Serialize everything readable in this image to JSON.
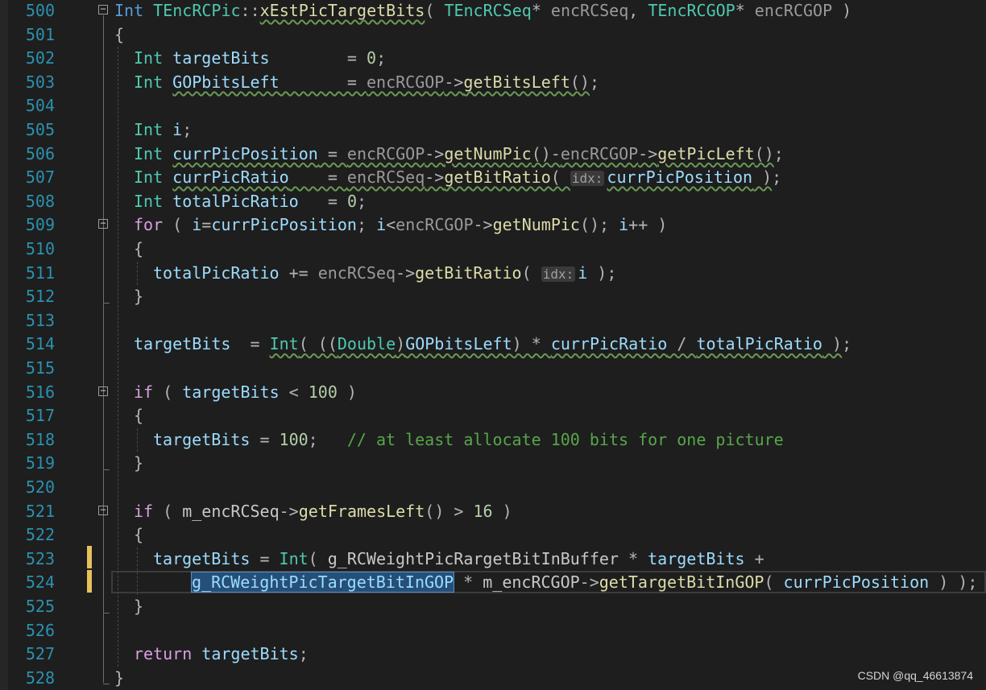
{
  "editor": {
    "line_numbers": [
      "500",
      "501",
      "502",
      "503",
      "504",
      "505",
      "506",
      "507",
      "508",
      "509",
      "510",
      "511",
      "512",
      "513",
      "514",
      "515",
      "516",
      "517",
      "518",
      "519",
      "520",
      "521",
      "522",
      "523",
      "524",
      "525",
      "526",
      "527",
      "528"
    ],
    "fold_glyph": "−",
    "lines": [
      {
        "indent": 0,
        "tokens": [
          {
            "c": "keyword",
            "t": "Int "
          },
          {
            "c": "type",
            "t": "TEncRCPic"
          },
          {
            "c": "punct",
            "t": "::"
          },
          {
            "c": "func",
            "t": "xEstPicTargetBits",
            "sq": true
          },
          {
            "c": "punct",
            "t": "( "
          },
          {
            "c": "type",
            "t": "TEncRCSeq"
          },
          {
            "c": "punct",
            "t": "* "
          },
          {
            "c": "param",
            "t": "encRCSeq"
          },
          {
            "c": "punct",
            "t": ", "
          },
          {
            "c": "type",
            "t": "TEncRCGOP"
          },
          {
            "c": "punct",
            "t": "* "
          },
          {
            "c": "param",
            "t": "encRCGOP"
          },
          {
            "c": "punct",
            "t": " )"
          }
        ]
      },
      {
        "indent": 0,
        "tokens": [
          {
            "c": "punct",
            "t": "{"
          }
        ]
      },
      {
        "indent": 1,
        "tokens": [
          {
            "c": "type",
            "t": "Int "
          },
          {
            "c": "var",
            "t": "targetBits"
          },
          {
            "c": "punct",
            "t": "        = "
          },
          {
            "c": "num",
            "t": "0"
          },
          {
            "c": "punct",
            "t": ";"
          }
        ]
      },
      {
        "indent": 1,
        "tokens": [
          {
            "c": "type",
            "t": "Int "
          },
          {
            "c": "var",
            "t": "GOPbitsLeft",
            "sq": true
          },
          {
            "c": "punct",
            "t": "       = ",
            "sq": true
          },
          {
            "c": "param",
            "t": "encRCGOP",
            "sq": true
          },
          {
            "c": "punct",
            "t": "->",
            "sq": true
          },
          {
            "c": "func",
            "t": "getBitsLeft",
            "sq": true
          },
          {
            "c": "punct",
            "t": "()",
            "sq": true
          },
          {
            "c": "punct",
            "t": ";"
          }
        ]
      },
      {
        "indent": 1,
        "tokens": []
      },
      {
        "indent": 1,
        "tokens": [
          {
            "c": "type",
            "t": "Int "
          },
          {
            "c": "var",
            "t": "i"
          },
          {
            "c": "punct",
            "t": ";"
          }
        ]
      },
      {
        "indent": 1,
        "tokens": [
          {
            "c": "type",
            "t": "Int "
          },
          {
            "c": "var",
            "t": "currPicPosition",
            "sq": true
          },
          {
            "c": "punct",
            "t": " = ",
            "sq": true
          },
          {
            "c": "param",
            "t": "encRCGOP",
            "sq": true
          },
          {
            "c": "punct",
            "t": "->",
            "sq": true
          },
          {
            "c": "func",
            "t": "getNumPic",
            "sq": true
          },
          {
            "c": "punct",
            "t": "()-",
            "sq": true
          },
          {
            "c": "param",
            "t": "encRCGOP",
            "sq": true
          },
          {
            "c": "punct",
            "t": "->",
            "sq": true
          },
          {
            "c": "func",
            "t": "getPicLeft",
            "sq": true
          },
          {
            "c": "punct",
            "t": "()",
            "sq": true
          },
          {
            "c": "punct",
            "t": ";"
          }
        ]
      },
      {
        "indent": 1,
        "tokens": [
          {
            "c": "type",
            "t": "Int "
          },
          {
            "c": "var",
            "t": "currPicRatio",
            "sq": true
          },
          {
            "c": "punct",
            "t": "    = ",
            "sq": true
          },
          {
            "c": "param",
            "t": "encRCSeq",
            "sq": true
          },
          {
            "c": "punct",
            "t": "->",
            "sq": true
          },
          {
            "c": "func",
            "t": "getBitRatio",
            "sq": true
          },
          {
            "c": "punct",
            "t": "( ",
            "sq": true
          },
          {
            "c": "hint",
            "t": "idx:"
          },
          {
            "c": "var",
            "t": "currPicPosition",
            "sq": true
          },
          {
            "c": "punct",
            "t": " )",
            "sq": true
          },
          {
            "c": "punct",
            "t": ";"
          }
        ]
      },
      {
        "indent": 1,
        "tokens": [
          {
            "c": "type",
            "t": "Int "
          },
          {
            "c": "var",
            "t": "totalPicRatio"
          },
          {
            "c": "punct",
            "t": "   = "
          },
          {
            "c": "num",
            "t": "0"
          },
          {
            "c": "punct",
            "t": ";"
          }
        ]
      },
      {
        "indent": 1,
        "tokens": [
          {
            "c": "ctrl",
            "t": "for"
          },
          {
            "c": "punct",
            "t": " ( "
          },
          {
            "c": "var",
            "t": "i"
          },
          {
            "c": "punct",
            "t": "="
          },
          {
            "c": "var",
            "t": "currPicPosition"
          },
          {
            "c": "punct",
            "t": "; "
          },
          {
            "c": "var",
            "t": "i"
          },
          {
            "c": "punct",
            "t": "<"
          },
          {
            "c": "param",
            "t": "encRCGOP"
          },
          {
            "c": "punct",
            "t": "->"
          },
          {
            "c": "func",
            "t": "getNumPic"
          },
          {
            "c": "punct",
            "t": "(); "
          },
          {
            "c": "var",
            "t": "i"
          },
          {
            "c": "punct",
            "t": "++ )"
          }
        ]
      },
      {
        "indent": 1,
        "tokens": [
          {
            "c": "punct",
            "t": "{"
          }
        ]
      },
      {
        "indent": 2,
        "tokens": [
          {
            "c": "var",
            "t": "totalPicRatio"
          },
          {
            "c": "punct",
            "t": " += "
          },
          {
            "c": "param",
            "t": "encRCSeq"
          },
          {
            "c": "punct",
            "t": "->"
          },
          {
            "c": "func",
            "t": "getBitRatio"
          },
          {
            "c": "punct",
            "t": "( "
          },
          {
            "c": "hint",
            "t": "idx:"
          },
          {
            "c": "var",
            "t": "i"
          },
          {
            "c": "punct",
            "t": " );"
          }
        ]
      },
      {
        "indent": 1,
        "tokens": [
          {
            "c": "punct",
            "t": "}"
          }
        ]
      },
      {
        "indent": 1,
        "tokens": []
      },
      {
        "indent": 1,
        "tokens": [
          {
            "c": "var",
            "t": "targetBits"
          },
          {
            "c": "punct",
            "t": "  = "
          },
          {
            "c": "type",
            "t": "Int",
            "sq": true
          },
          {
            "c": "punct",
            "t": "( ((",
            "sq": true
          },
          {
            "c": "type",
            "t": "Double",
            "sq": true
          },
          {
            "c": "punct",
            "t": ")",
            "sq": true
          },
          {
            "c": "var",
            "t": "GOPbitsLeft",
            "sq": true
          },
          {
            "c": "punct",
            "t": ") * ",
            "sq": true
          },
          {
            "c": "var",
            "t": "currPicRatio",
            "sq": true
          },
          {
            "c": "punct",
            "t": " / ",
            "sq": true
          },
          {
            "c": "var",
            "t": "totalPicRatio",
            "sq": true
          },
          {
            "c": "punct",
            "t": " )",
            "sq": true
          },
          {
            "c": "punct",
            "t": ";"
          }
        ]
      },
      {
        "indent": 1,
        "tokens": []
      },
      {
        "indent": 1,
        "tokens": [
          {
            "c": "ctrl",
            "t": "if"
          },
          {
            "c": "punct",
            "t": " ( "
          },
          {
            "c": "var",
            "t": "targetBits"
          },
          {
            "c": "punct",
            "t": " < "
          },
          {
            "c": "num",
            "t": "100"
          },
          {
            "c": "punct",
            "t": " )"
          }
        ]
      },
      {
        "indent": 1,
        "tokens": [
          {
            "c": "punct",
            "t": "{"
          }
        ]
      },
      {
        "indent": 2,
        "tokens": [
          {
            "c": "var",
            "t": "targetBits"
          },
          {
            "c": "punct",
            "t": " = "
          },
          {
            "c": "num",
            "t": "100"
          },
          {
            "c": "punct",
            "t": ";   "
          },
          {
            "c": "comment",
            "t": "// at least allocate 100 bits for one picture"
          }
        ]
      },
      {
        "indent": 1,
        "tokens": [
          {
            "c": "punct",
            "t": "}"
          }
        ]
      },
      {
        "indent": 1,
        "tokens": []
      },
      {
        "indent": 1,
        "tokens": [
          {
            "c": "ctrl",
            "t": "if"
          },
          {
            "c": "punct",
            "t": " ( "
          },
          {
            "c": "plain",
            "t": "m_encRCSeq"
          },
          {
            "c": "punct",
            "t": "->"
          },
          {
            "c": "func",
            "t": "getFramesLeft"
          },
          {
            "c": "punct",
            "t": "() > "
          },
          {
            "c": "num",
            "t": "16"
          },
          {
            "c": "punct",
            "t": " )"
          }
        ]
      },
      {
        "indent": 1,
        "tokens": [
          {
            "c": "punct",
            "t": "{"
          }
        ]
      },
      {
        "indent": 2,
        "tokens": [
          {
            "c": "var",
            "t": "targetBits"
          },
          {
            "c": "punct",
            "t": " = "
          },
          {
            "c": "type",
            "t": "Int"
          },
          {
            "c": "punct",
            "t": "( "
          },
          {
            "c": "plain",
            "t": "g_RCWeightPicRargetBitInBuffer"
          },
          {
            "c": "punct",
            "t": " * "
          },
          {
            "c": "var",
            "t": "targetBits"
          },
          {
            "c": "punct",
            "t": " +"
          }
        ]
      },
      {
        "indent": 4,
        "tokens": [
          {
            "c": "sel",
            "t": "g_RCWeightPicTargetBitInGOP"
          },
          {
            "c": "punct",
            "t": " * "
          },
          {
            "c": "plain",
            "t": "m_encRCGOP"
          },
          {
            "c": "punct",
            "t": "->"
          },
          {
            "c": "func",
            "t": "getTargetBitInGOP"
          },
          {
            "c": "punct",
            "t": "( "
          },
          {
            "c": "var",
            "t": "currPicPosition"
          },
          {
            "c": "punct",
            "t": " ) );"
          }
        ]
      },
      {
        "indent": 1,
        "tokens": [
          {
            "c": "punct",
            "t": "}"
          }
        ]
      },
      {
        "indent": 1,
        "tokens": []
      },
      {
        "indent": 1,
        "tokens": [
          {
            "c": "ctrl",
            "t": "return"
          },
          {
            "c": "punct",
            "t": " "
          },
          {
            "c": "var",
            "t": "targetBits"
          },
          {
            "c": "punct",
            "t": ";"
          }
        ]
      },
      {
        "indent": 0,
        "tokens": [
          {
            "c": "punct",
            "t": "}"
          }
        ]
      }
    ]
  },
  "watermark": "CSDN @qq_46613874"
}
